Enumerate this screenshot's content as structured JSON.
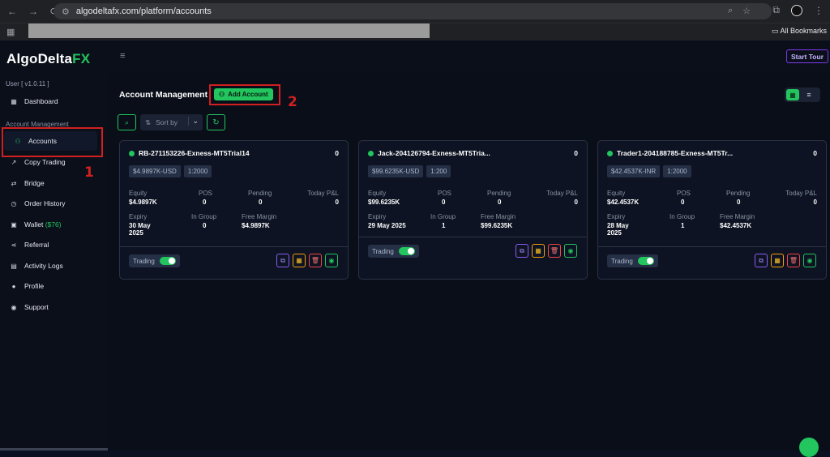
{
  "browser": {
    "back": "←",
    "forward": "→",
    "reload": "⟳",
    "url": "algodeltafx.com/platform/accounts",
    "all_bookmarks": "All Bookmarks"
  },
  "sidebar": {
    "logo_main": "AlgoDelta",
    "logo_accent": "FX",
    "version": "User [ v1.0.11 ]",
    "section_label": "Account Management",
    "items": [
      {
        "label": "Dashboard",
        "icon": "▦"
      },
      {
        "label": "Accounts",
        "icon": "⚇"
      },
      {
        "label": "Copy Trading",
        "icon": "↗"
      },
      {
        "label": "Bridge",
        "icon": "⇄"
      },
      {
        "label": "Order History",
        "icon": "◷"
      },
      {
        "label": "Wallet",
        "icon": "▣",
        "extra": "($76)"
      },
      {
        "label": "Referral",
        "icon": "⋖"
      },
      {
        "label": "Activity Logs",
        "icon": "▤"
      },
      {
        "label": "Profile",
        "icon": "●"
      },
      {
        "label": "Support",
        "icon": "◉"
      }
    ]
  },
  "topbar": {
    "menu_icon": "≡",
    "start_tour": "Start Tour"
  },
  "page": {
    "title": "Account Management",
    "add_button": "Add Account",
    "sort_placeholder": "Sort by",
    "annotation_1": "1",
    "annotation_2": "2"
  },
  "stat_labels": {
    "equity": "Equity",
    "pos": "POS",
    "pending": "Pending",
    "today_pl": "Today P&L",
    "expiry": "Expiry",
    "in_group": "In Group",
    "free_margin": "Free Margin",
    "trading": "Trading"
  },
  "accounts": [
    {
      "name": "RB-271153226-Exness-MT5Trial14",
      "count": "0",
      "balance_tag": "$4.9897K-USD",
      "leverage_tag": "1:2000",
      "equity": "$4.9897K",
      "pos": "0",
      "pending": "0",
      "today_pl": "0",
      "expiry_line1": "30 May",
      "expiry_line2": "2025",
      "in_group": "0",
      "free_margin": "$4.9897K"
    },
    {
      "name": "Jack-204126794-Exness-MT5Tria...",
      "count": "0",
      "balance_tag": "$99.6235K-USD",
      "leverage_tag": "1:200",
      "equity": "$99.6235K",
      "pos": "0",
      "pending": "0",
      "today_pl": "0",
      "expiry_line1": "29 May 2025",
      "expiry_line2": "",
      "in_group": "1",
      "free_margin": "$99.6235K"
    },
    {
      "name": "Trader1-204188785-Exness-MT5Tr...",
      "count": "0",
      "balance_tag": "$42.4537K-INR",
      "leverage_tag": "1:2000",
      "equity": "$42.4537K",
      "pos": "0",
      "pending": "0",
      "today_pl": "0",
      "expiry_line1": "28 May",
      "expiry_line2": "2025",
      "in_group": "1",
      "free_margin": "$42.4537K"
    }
  ],
  "colors": {
    "accent_green": "#22c55e",
    "annotation_red": "#d02020",
    "tour_purple": "#7c3aed"
  }
}
